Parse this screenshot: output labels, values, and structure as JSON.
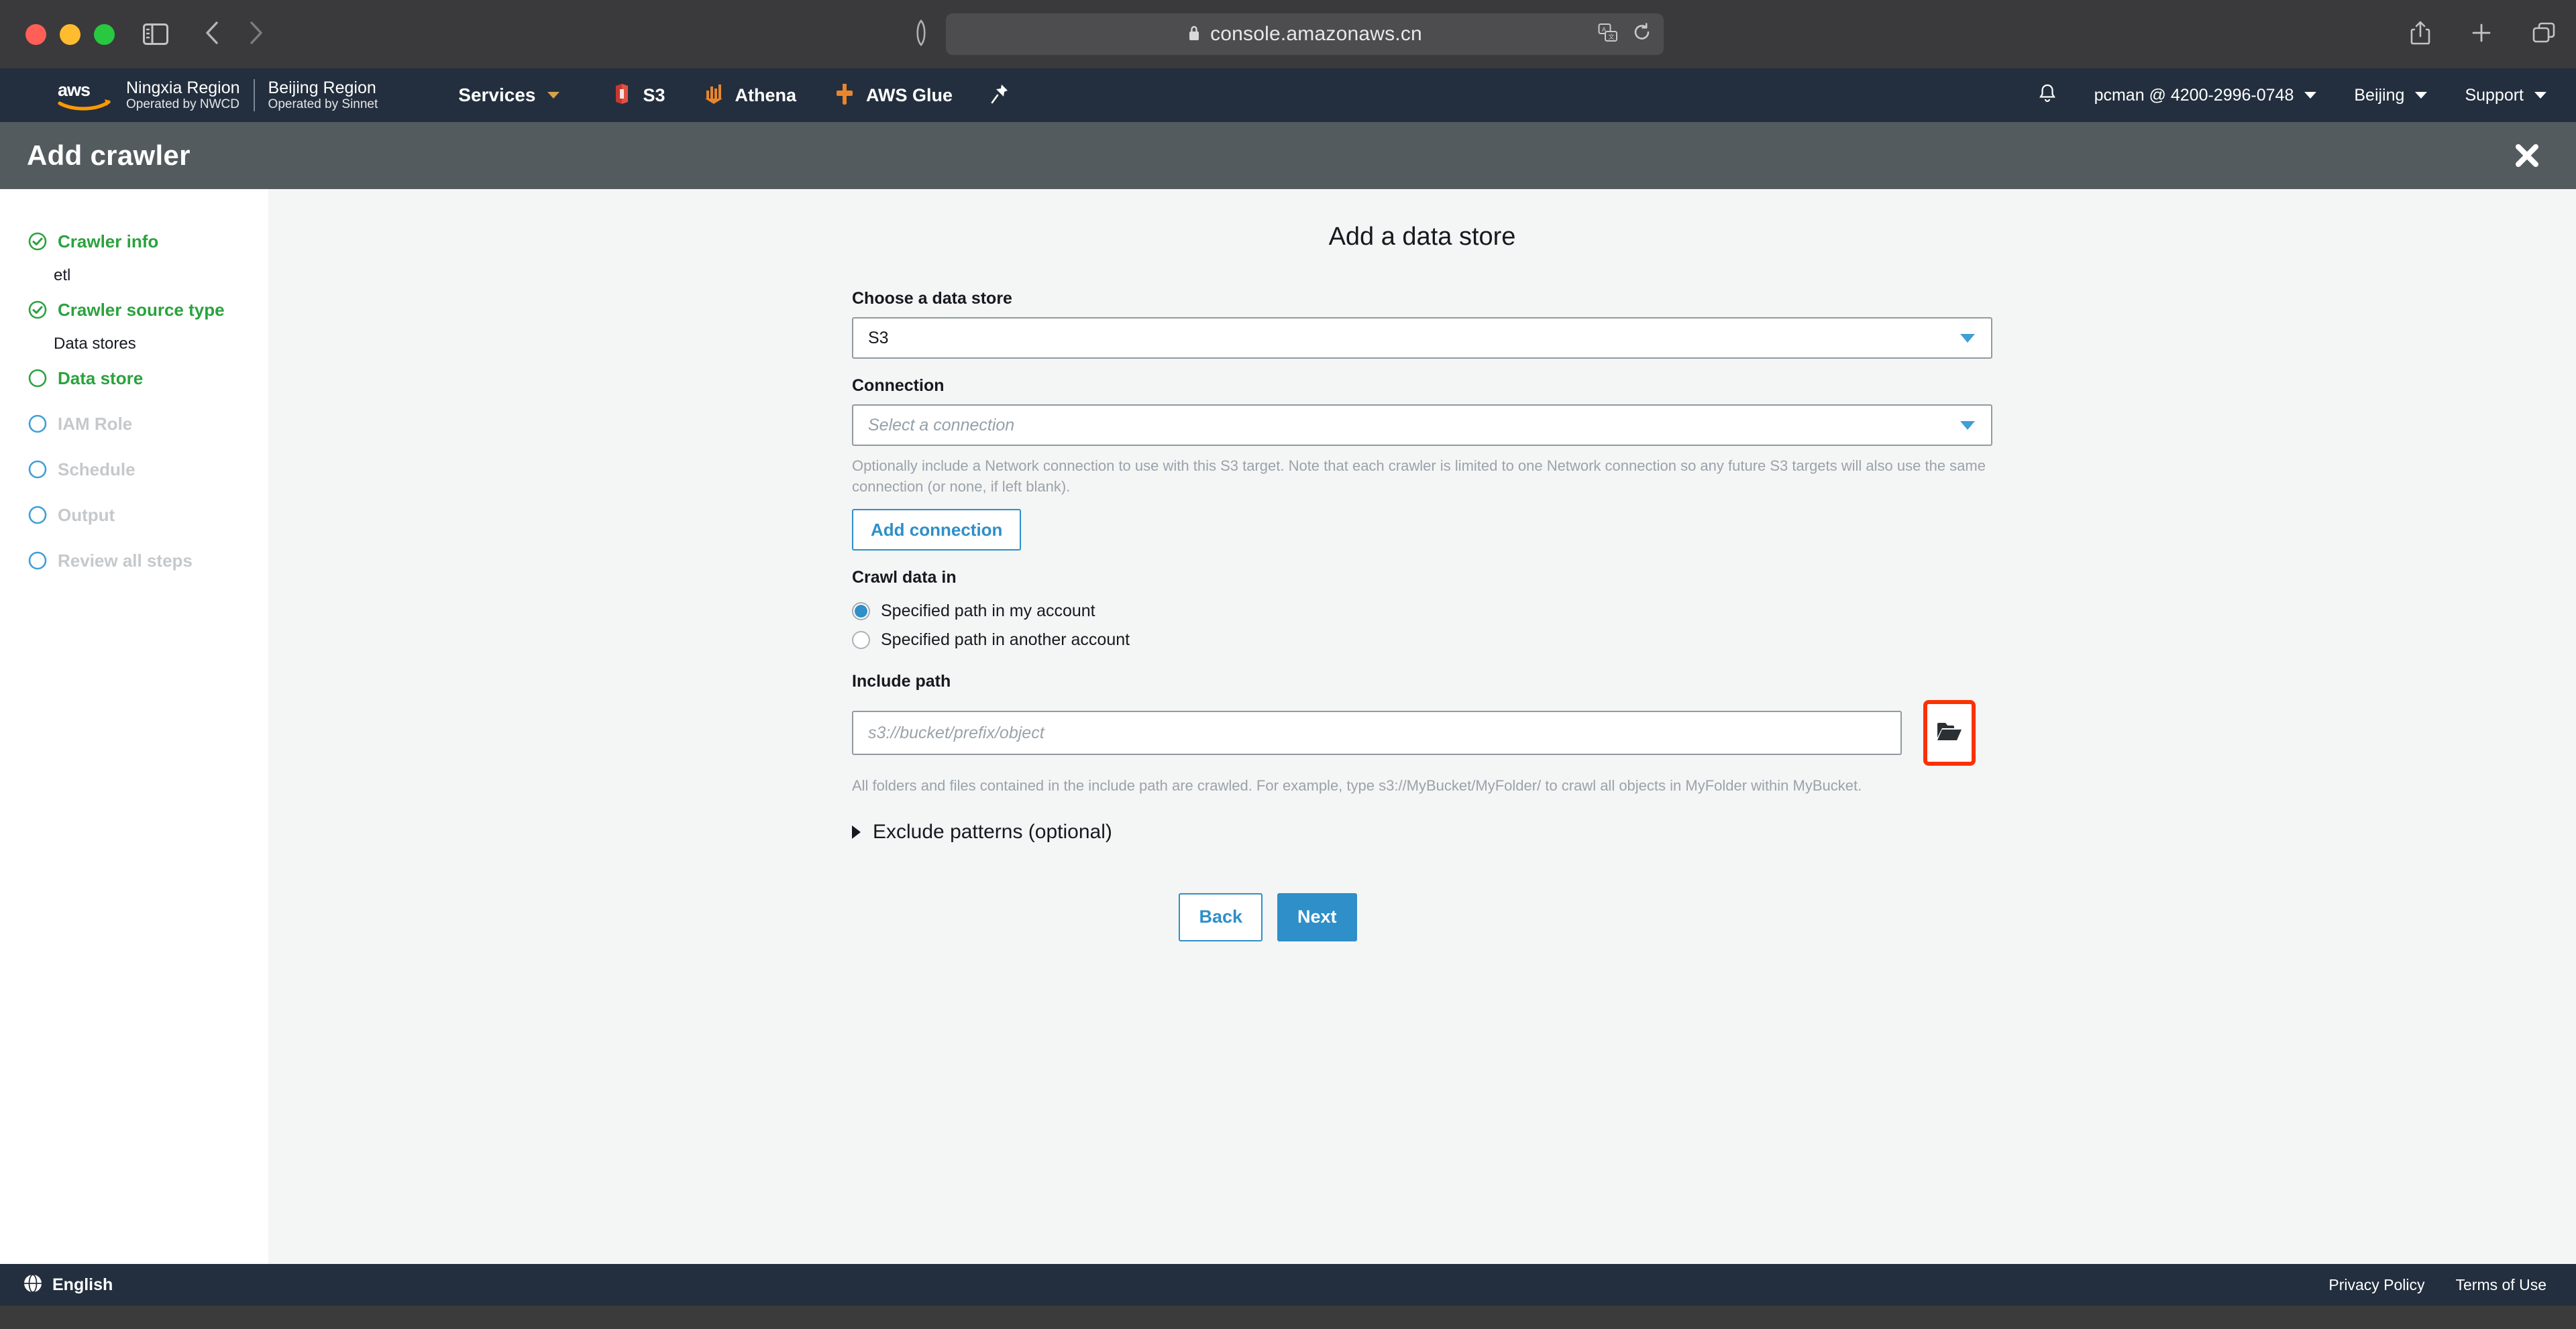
{
  "browser": {
    "url": "console.amazonaws.cn",
    "lock_icon": "lock-icon",
    "sidebar_toggle_icon": "sidebar-toggle-icon",
    "back_icon": "back-arrow-icon",
    "forward_icon": "forward-arrow-icon",
    "reader_icon": "reader-view-icon",
    "translate_icon": "translate-icon",
    "reload_icon": "reload-icon",
    "share_icon": "share-icon",
    "new_tab_icon": "plus-icon",
    "tabs_icon": "tab-overview-icon"
  },
  "aws_nav": {
    "logo_alt": "aws-logo",
    "regions": [
      {
        "name": "Ningxia Region",
        "operator": "Operated by NWCD"
      },
      {
        "name": "Beijing Region",
        "operator": "Operated by Sinnet"
      }
    ],
    "services_label": "Services",
    "shortcuts": [
      {
        "label": "S3",
        "icon": "s3-icon",
        "color": "#e05243"
      },
      {
        "label": "Athena",
        "icon": "athena-icon",
        "color": "#e8862d"
      },
      {
        "label": "AWS Glue",
        "icon": "aws-glue-icon",
        "color": "#e8862d"
      }
    ],
    "pin_icon": "pin-icon",
    "bell_icon": "bell-notification-icon",
    "account_label": "pcman @ 4200-2996-0748",
    "region_label": "Beijing",
    "support_label": "Support"
  },
  "page_header": {
    "title": "Add crawler",
    "close_icon": "close-icon"
  },
  "sidebar": {
    "steps": [
      {
        "label": "Crawler info",
        "state": "done",
        "sub": "etl"
      },
      {
        "label": "Crawler source type",
        "state": "done",
        "sub": "Data stores"
      },
      {
        "label": "Data store",
        "state": "active",
        "sub": null
      },
      {
        "label": "IAM Role",
        "state": "todo",
        "sub": null
      },
      {
        "label": "Schedule",
        "state": "todo",
        "sub": null
      },
      {
        "label": "Output",
        "state": "todo",
        "sub": null
      },
      {
        "label": "Review all steps",
        "state": "todo",
        "sub": null
      }
    ]
  },
  "form": {
    "heading": "Add a data store",
    "data_store": {
      "label": "Choose a data store",
      "value": "S3"
    },
    "connection": {
      "label": "Connection",
      "placeholder": "Select a connection",
      "helper": "Optionally include a Network connection to use with this S3 target. Note that each crawler is limited to one Network connection so any future S3 targets will also use the same connection (or none, if left blank).",
      "add_button": "Add connection"
    },
    "crawl_data_in": {
      "label": "Crawl data in",
      "options": [
        {
          "label": "Specified path in my account",
          "checked": true
        },
        {
          "label": "Specified path in another account",
          "checked": false
        }
      ]
    },
    "include_path": {
      "label": "Include path",
      "value": "",
      "placeholder": "s3://bucket/prefix/object",
      "helper": "All folders and files contained in the include path are crawled. For example, type s3://MyBucket/MyFolder/ to crawl all objects in MyFolder within MyBucket.",
      "browse_icon": "folder-open-icon",
      "highlight_color": "#fa3200"
    },
    "exclude_patterns": {
      "label": "Exclude patterns (optional)",
      "expanded": false
    },
    "buttons": {
      "back": "Back",
      "next": "Next"
    }
  },
  "footer": {
    "language": "English",
    "globe_icon": "globe-icon",
    "links": [
      "Privacy Policy",
      "Terms of Use"
    ]
  },
  "colors": {
    "aws_navy": "#232f3e",
    "header_gray": "#545b5f",
    "accent_blue": "#2e8fc9",
    "success_green": "#2ba23e",
    "highlight_red": "#fa3200"
  }
}
